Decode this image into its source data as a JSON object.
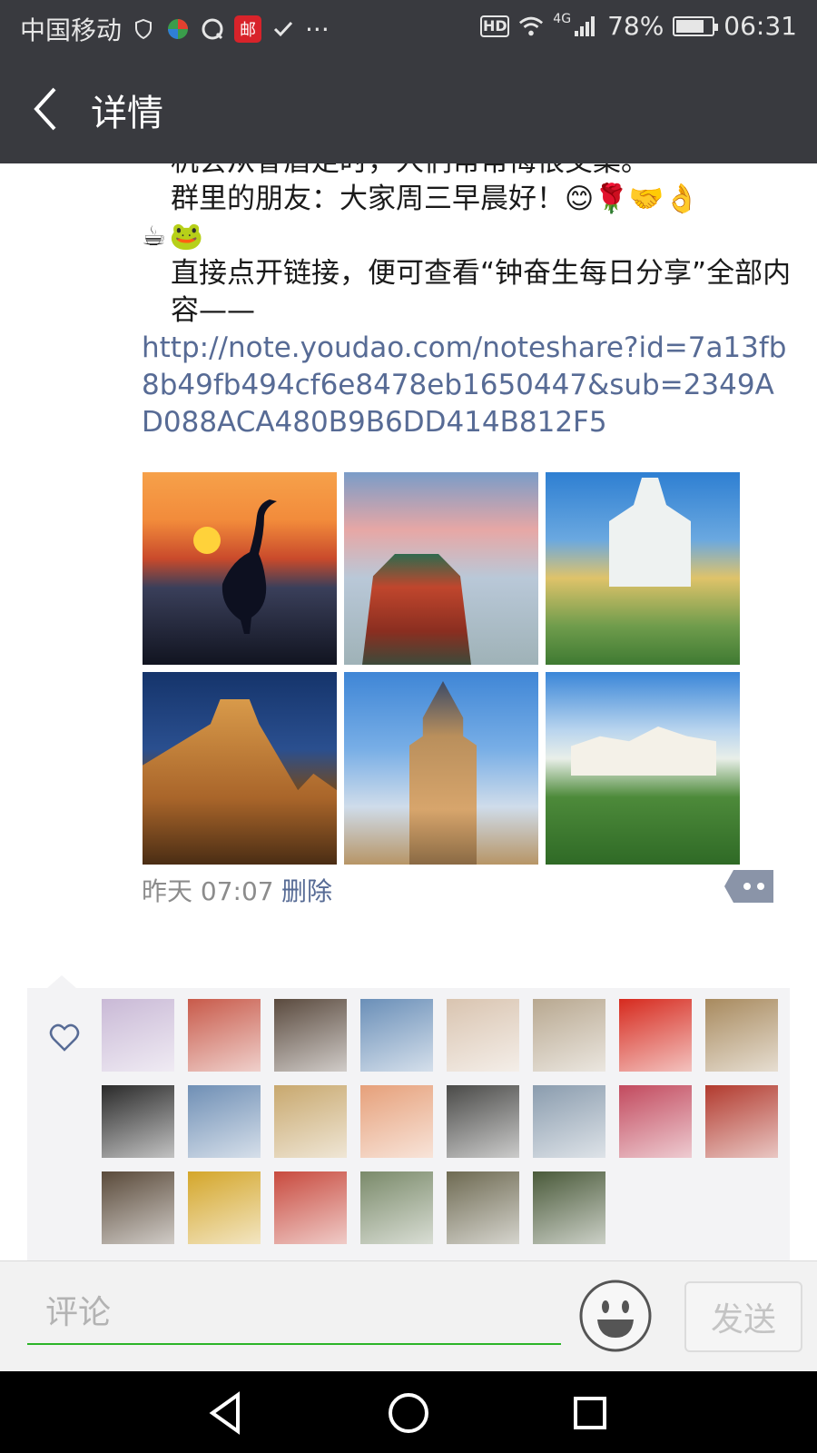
{
  "status_bar": {
    "carrier": "中国移动",
    "more": "···",
    "mail_label": "邮",
    "hd": "HD",
    "network": "4G",
    "battery_percent": 78,
    "battery_label": "78%",
    "time": "06:31"
  },
  "nav": {
    "title": "详情"
  },
  "post": {
    "line_cutoff": "机会从眷盾走时，人们常常悔恨交集。",
    "greeting": "群里的朋友：大家周三早晨好！😊🌹🤝👌",
    "greeting_emojis": "☕🐸",
    "instruction": "直接点开链接，便可查看“钟奋生每日分享”全部内容——",
    "link": "http://note.youdao.com/noteshare?id=7a13fb8b49fb494cf6e8478eb1650447&sub=2349AD088ACA480B9B6DD414B812F5",
    "photos": [
      {
        "name": "photo-heron-sunset"
      },
      {
        "name": "photo-pagoda"
      },
      {
        "name": "photo-church-town"
      },
      {
        "name": "photo-castle-night"
      },
      {
        "name": "photo-castle-tower"
      },
      {
        "name": "photo-fortress-hill"
      }
    ],
    "time": "昨天 07:07",
    "delete_label": "删除"
  },
  "likes": {
    "avatars": [
      {
        "color": "#c9b9d6"
      },
      {
        "color": "#c85a4a"
      },
      {
        "color": "#5a4a3e"
      },
      {
        "color": "#6a8fb8"
      },
      {
        "color": "#d9c4b0"
      },
      {
        "color": "#b8a890"
      },
      {
        "color": "#d62a1e"
      },
      {
        "color": "#a88a5e"
      },
      {
        "color": "#2a2a2a"
      },
      {
        "color": "#6f8fb5"
      },
      {
        "color": "#c8a86e"
      },
      {
        "color": "#e6a07a"
      },
      {
        "color": "#4a4a48"
      },
      {
        "color": "#8a9cae"
      },
      {
        "color": "#c24a5e"
      },
      {
        "color": "#b23a2e"
      },
      {
        "color": "#5a4a3a"
      },
      {
        "color": "#d4a62a"
      },
      {
        "color": "#c84a3e"
      },
      {
        "color": "#7a8a6a"
      },
      {
        "color": "#6e6a52"
      },
      {
        "color": "#4a5a3a"
      }
    ]
  },
  "comment": {
    "placeholder": "评论",
    "send_label": "发送"
  }
}
